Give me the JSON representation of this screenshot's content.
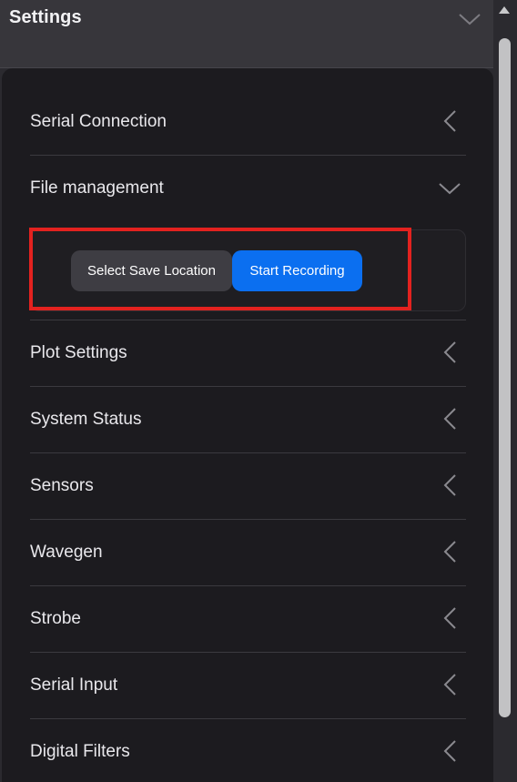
{
  "header": {
    "title": "Settings"
  },
  "sections": [
    {
      "label": "Serial Connection"
    },
    {
      "label": "File management"
    },
    {
      "label": "Plot Settings"
    },
    {
      "label": "System Status"
    },
    {
      "label": "Sensors"
    },
    {
      "label": "Wavegen"
    },
    {
      "label": "Strobe"
    },
    {
      "label": "Serial Input"
    },
    {
      "label": "Digital Filters"
    }
  ],
  "file_management": {
    "select_location_label": "Select Save Location",
    "start_recording_label": "Start Recording"
  },
  "colors": {
    "background": "#1c1b1f",
    "primary_button": "#0b6ff0",
    "secondary_button": "#3e3d43",
    "highlight": "#e3221f"
  }
}
